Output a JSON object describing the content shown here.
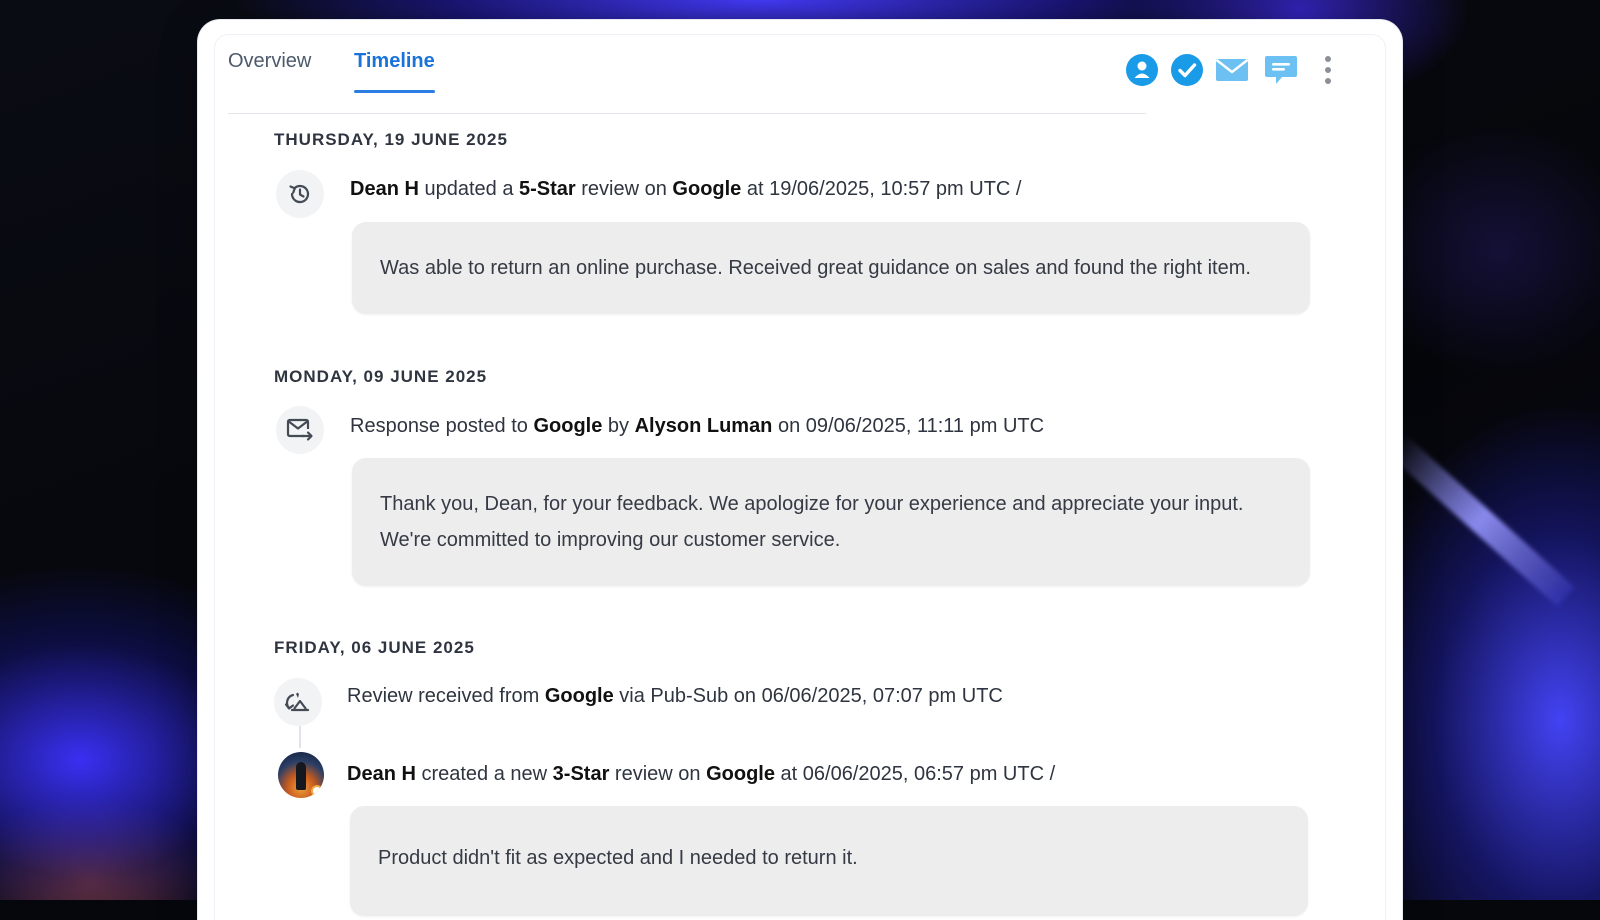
{
  "tabs": [
    {
      "label": "Overview",
      "active": false
    },
    {
      "label": "Timeline",
      "active": true
    }
  ],
  "toolbar": {
    "icons": [
      "user-icon",
      "check-icon",
      "mail-icon",
      "chat-icon",
      "more-vertical-icon"
    ],
    "accent": "#1a9be8"
  },
  "timeline": [
    {
      "date": "THURSDAY, 19 JUNE 2025",
      "events": [
        {
          "icon": "history-icon",
          "parts": [
            "Dean H",
            " updated a ",
            "5-Star",
            " review on ",
            "Google",
            " at 19/06/2025, 10:57 pm UTC /"
          ],
          "text": [
            "Was able to return an online purchase. Received great guidance on sales and found the right item."
          ]
        }
      ]
    },
    {
      "date": "MONDAY, 09 JUNE 2025",
      "events": [
        {
          "icon": "mail-forward-icon",
          "parts": [
            "Response posted to ",
            "Google",
            " by ",
            "Alyson Luman",
            " on 09/06/2025, 11:11 pm UTC"
          ],
          "text": [
            "Thank you, Dean, for your feedback. We apologize for your experience and appreciate your input.",
            "We're committed to improving our customer service."
          ]
        }
      ]
    },
    {
      "date": "FRIDAY, 06 JUNE 2025",
      "events": [
        {
          "icon": "sync-icon",
          "parts": [
            "Review received from ",
            "Google",
            " via Pub-Sub on 06/06/2025, 07:07 pm UTC"
          ]
        },
        {
          "icon": "avatar",
          "parts": [
            "Dean H",
            " created a new ",
            "3-Star",
            " review on ",
            "Google",
            " at 06/06/2025, 06:57 pm UTC /"
          ],
          "text": [
            "Product didn't fit as expected and I needed to return it."
          ]
        }
      ]
    }
  ]
}
